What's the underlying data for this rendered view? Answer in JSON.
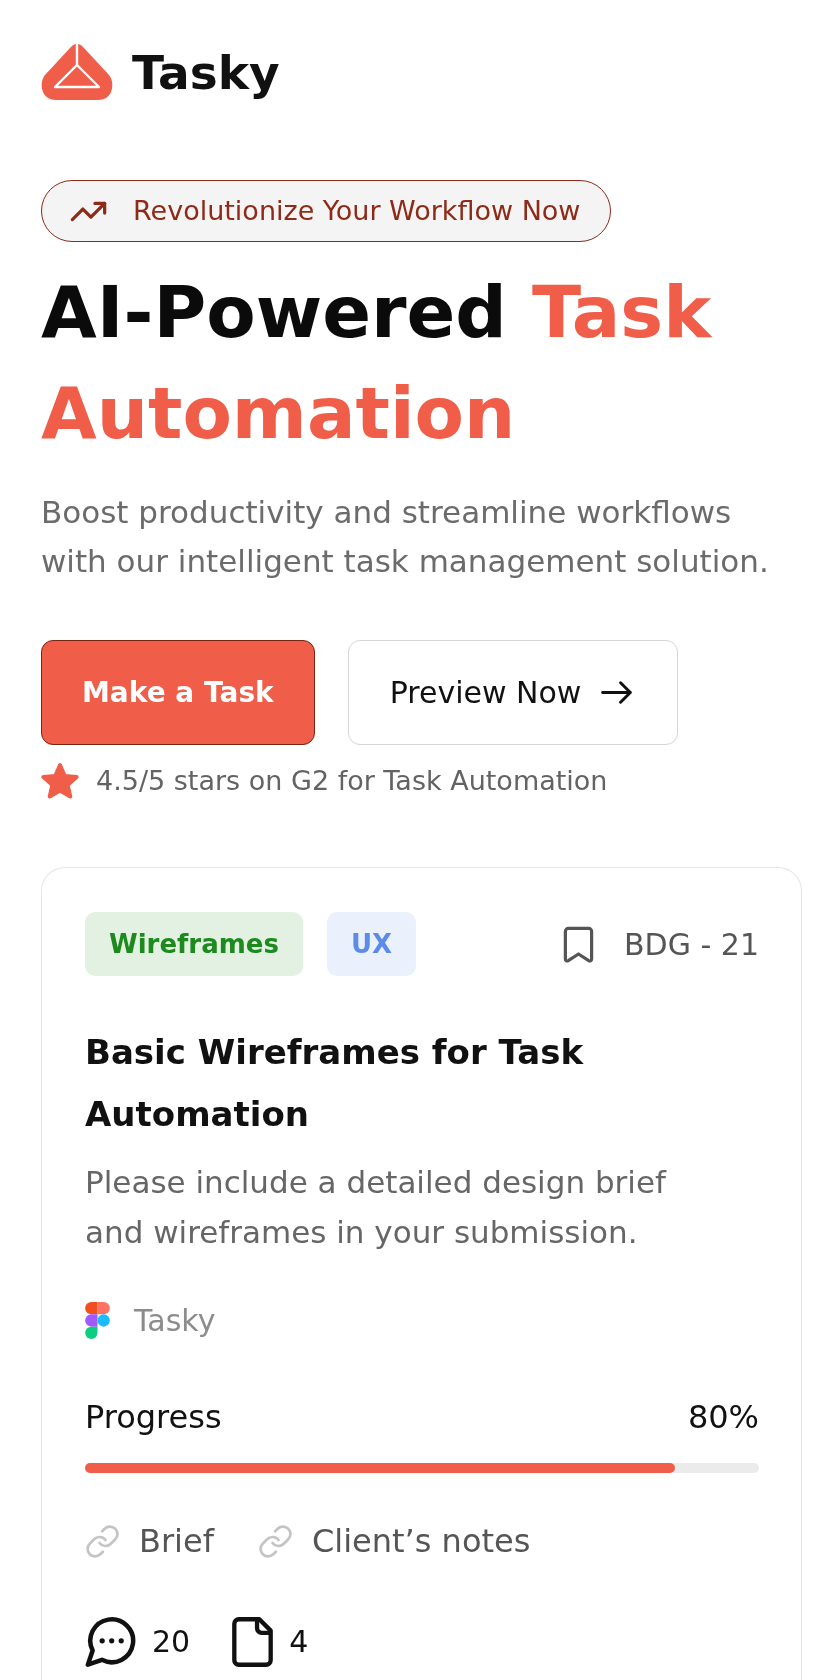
{
  "header": {
    "brand": "Tasky"
  },
  "hero": {
    "badge": "Revolutionize Your Workflow Now",
    "heading": {
      "text": "AI-Powered",
      "highlight": "Task Automation"
    },
    "subtitle": "Boost productivity and streamline workflows with our intelligent task management solution.",
    "buttons": [
      {
        "label": "Make a Task",
        "kind": "primary"
      },
      {
        "label": "Preview Now",
        "kind": "secondary"
      }
    ],
    "rating": "4.5/5 stars on G2 for Task Automation"
  },
  "task_card": {
    "tags": [
      {
        "label": "Wireframes",
        "color": "#1c8a1c"
      },
      {
        "label": "UX",
        "color": "#5b8de8"
      }
    ],
    "code": "BDG - 21",
    "title": "Basic Wireframes for Task Automation",
    "description": "Please include a detailed design brief and wireframes in your submission.",
    "project": "Tasky",
    "progress": {
      "label": "Progress",
      "reading": "80%",
      "level": 0.875
    },
    "links": [
      {
        "label": "Brief"
      },
      {
        "label": "Client’s notes"
      }
    ],
    "counts": [
      {
        "kind": "comments",
        "value": "20"
      },
      {
        "kind": "files",
        "value": "4"
      }
    ]
  }
}
